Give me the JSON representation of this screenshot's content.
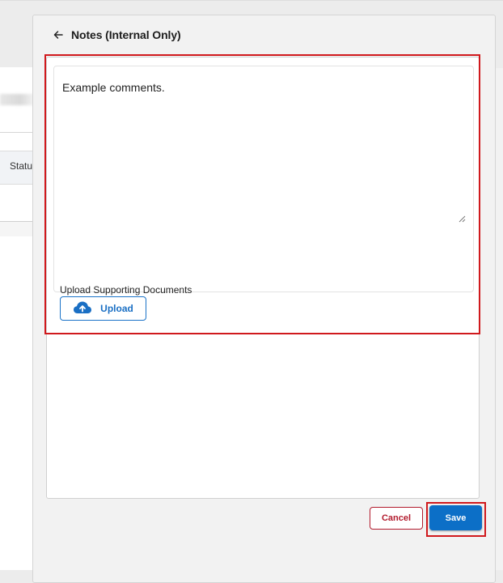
{
  "background": {
    "column_header": "Statu"
  },
  "panel": {
    "title": "Notes (Internal Only)",
    "back_icon": "arrow-left-icon"
  },
  "notes": {
    "value": "Example comments.",
    "placeholder": ""
  },
  "upload": {
    "label": "Upload Supporting Documents",
    "button_label": "Upload",
    "icon": "cloud-upload-icon"
  },
  "actions": {
    "cancel_label": "Cancel",
    "save_label": "Save"
  },
  "colors": {
    "primary": "#0c6fc7",
    "danger": "#b21b2d",
    "highlight": "#d0191d"
  }
}
